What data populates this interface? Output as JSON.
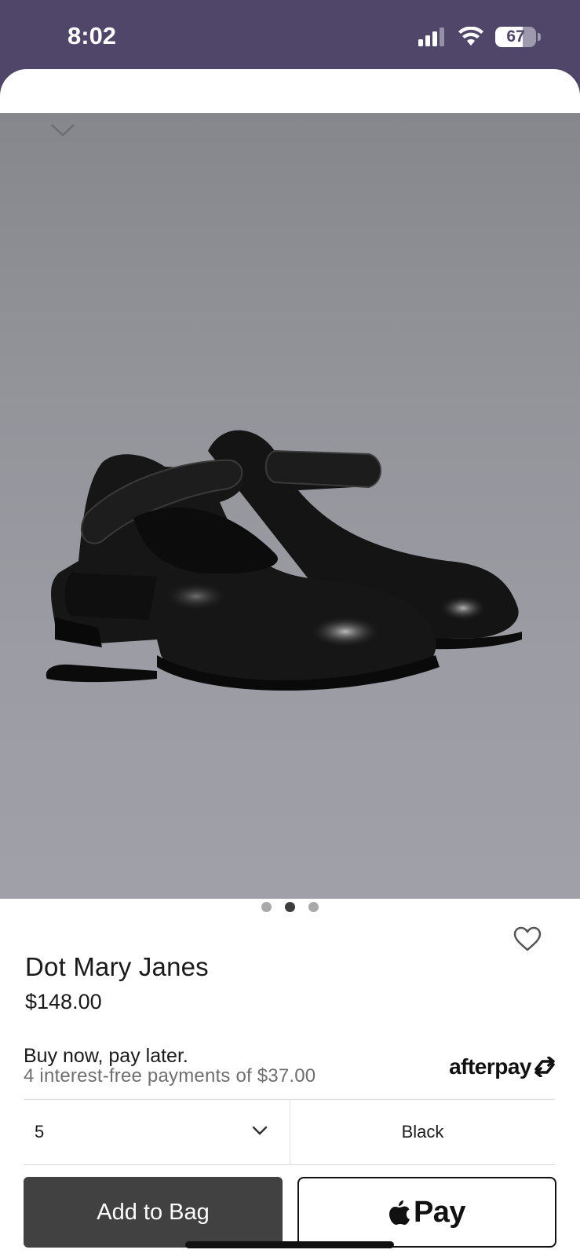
{
  "status_bar": {
    "time": "8:02",
    "battery_percent": "67",
    "battery_level": 0.67
  },
  "gallery": {
    "image_description_icon": "shoe-product-image",
    "page_count": 3,
    "active_index": 1
  },
  "product": {
    "name": "Dot Mary Janes",
    "price": "$148.00"
  },
  "bnpl": {
    "title": "Buy now, pay later.",
    "subtitle": "4 interest-free payments of $37.00",
    "provider": "afterpay"
  },
  "options": {
    "size": "5",
    "color": "Black"
  },
  "actions": {
    "add_to_bag": "Add to Bag",
    "apple_pay": "Pay"
  },
  "colors": {
    "status_bar_bg": "#4f4669",
    "button_dark": "#414141",
    "accent_text": "#1a1a1a"
  }
}
